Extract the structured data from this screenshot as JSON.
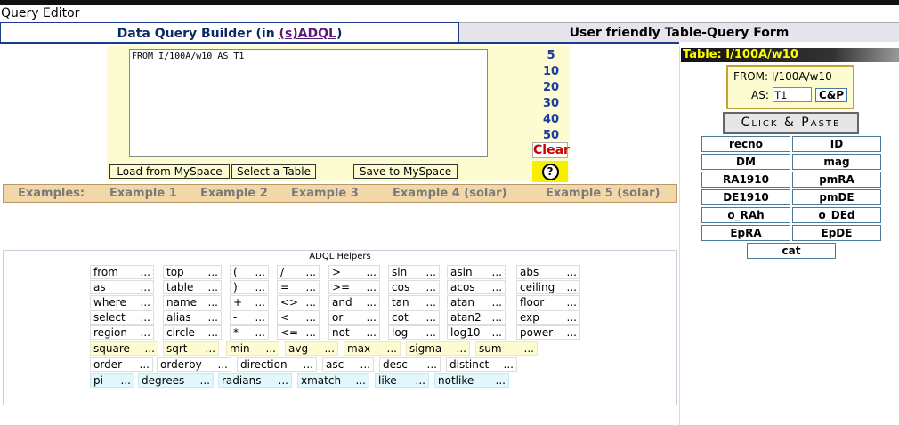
{
  "window_title": "Query Editor",
  "tabs": {
    "builder_prefix": "Data Query Builder (in ",
    "builder_link": "(s)ADQL",
    "builder_suffix": ")",
    "form": "User friendly Table-Query Form"
  },
  "editor": {
    "query_text": "FROM I/100A/w10 AS T1",
    "row_counts": [
      "5",
      "10",
      "20",
      "30",
      "40",
      "50"
    ],
    "clear_label": "Clear",
    "help_label": "?",
    "buttons": {
      "load": "Load from MySpace",
      "select": "Select a Table",
      "save": "Save to MySpace"
    }
  },
  "examples": {
    "label": "Examples:",
    "items": [
      "Example 1",
      "Example 2",
      "Example 3",
      "Example 4 (solar)",
      "Example 5 (solar)"
    ]
  },
  "helpers": {
    "title": "ADQL Helpers",
    "grid": [
      [
        "from",
        "top",
        "(",
        "/",
        ">",
        "sin",
        "asin",
        "abs"
      ],
      [
        "as",
        "table",
        ")",
        "=",
        ">=",
        "cos",
        "acos",
        "ceiling"
      ],
      [
        "where",
        "name",
        "+",
        "<>",
        "and",
        "tan",
        "atan",
        "floor"
      ],
      [
        "select",
        "alias",
        "-",
        "<",
        "or",
        "cot",
        "atan2",
        "exp"
      ],
      [
        "region",
        "circle",
        "*",
        "<=",
        "not",
        "log",
        "log10",
        "power"
      ]
    ],
    "aggregates": [
      "square",
      "sqrt",
      "min",
      "avg",
      "max",
      "sigma",
      "sum"
    ],
    "clauses": [
      "order",
      "orderby",
      "direction",
      "asc",
      "desc",
      "distinct"
    ],
    "misc": [
      "pi",
      "degrees",
      "radians",
      "xmatch",
      "like",
      "notlike"
    ],
    "dots": "..."
  },
  "sidebar": {
    "table_label": "Table: I/100A/w10",
    "from_text": "FROM: I/100A/w10",
    "as_label": "AS:",
    "as_value": "T1",
    "cp_small": "C&P",
    "click_paste": "Click & Paste",
    "columns": [
      "recno",
      "ID",
      "DM",
      "mag",
      "RA1910",
      "pmRA",
      "DE1910",
      "pmDE",
      "o_RAh",
      "o_DEd",
      "EpRA",
      "EpDE",
      "cat"
    ]
  },
  "colors": {
    "accent": "#1a3a8a",
    "editor_bg": "#fdfbd0",
    "examples_bg": "#f2d7a8",
    "clear_text": "#cc0000",
    "help_bg": "#f5f000",
    "cyan_keyword_bg": "#e0f7fb"
  }
}
